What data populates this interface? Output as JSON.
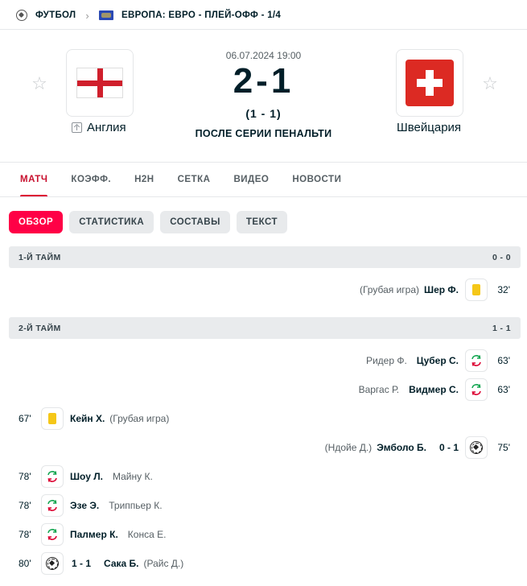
{
  "breadcrumb": {
    "sport": "ФУТБОЛ",
    "tournament": "ЕВРОПА: ЕВРО - ПЛЕЙ-ОФФ - 1/4"
  },
  "match": {
    "datetime": "06.07.2024 19:00",
    "score": "2-1",
    "half_score": "(1 - 1)",
    "status": "ПОСЛЕ СЕРИИ ПЕНАЛЬТИ",
    "home_team": "Англия",
    "away_team": "Швейцария"
  },
  "tabs": [
    "МАТЧ",
    "КОЭФФ.",
    "H2H",
    "СЕТКА",
    "ВИДЕО",
    "НОВОСТИ"
  ],
  "subtabs": [
    "ОБЗОР",
    "СТАТИСТИКА",
    "СОСТАВЫ",
    "ТЕКСТ"
  ],
  "periods": [
    {
      "label": "1-Й ТАЙМ",
      "score": "0 - 0"
    },
    {
      "label": "2-Й ТАЙМ",
      "score": "1 - 1"
    }
  ],
  "incidents": {
    "i1": {
      "minute": "32'",
      "player": "Шер Ф.",
      "note": "(Грубая игра)",
      "icon": "yellow-card-icon"
    },
    "i2": {
      "minute": "63'",
      "player": "Цубер С.",
      "out": "Ридер Ф.",
      "icon": "substitution-icon"
    },
    "i3": {
      "minute": "63'",
      "player": "Видмер С.",
      "out": "Варгас Р.",
      "icon": "substitution-icon"
    },
    "i4": {
      "minute": "67'",
      "player": "Кейн Х.",
      "note": "(Грубая игра)",
      "icon": "yellow-card-icon"
    },
    "i5": {
      "minute": "75'",
      "player": "Эмболо Б.",
      "assist": "(Ндойе Д.)",
      "score": "0 - 1",
      "icon": "ball-icon"
    },
    "i6": {
      "minute": "78'",
      "player": "Шоу Л.",
      "out": "Майну К.",
      "icon": "substitution-icon"
    },
    "i7": {
      "minute": "78'",
      "player": "Эзе Э.",
      "out": "Триппьер К.",
      "icon": "substitution-icon"
    },
    "i8": {
      "minute": "78'",
      "player": "Палмер К.",
      "out": "Конса Е.",
      "icon": "substitution-icon"
    },
    "i9": {
      "minute": "80'",
      "player": "Сака Б.",
      "assist": "(Райс Д.)",
      "score": "1 - 1",
      "icon": "ball-icon"
    }
  },
  "colors": {
    "accent": "#ff0046",
    "yellow_card": "#f5c718",
    "sub_in": "#12a550",
    "sub_out": "#dc0032"
  }
}
